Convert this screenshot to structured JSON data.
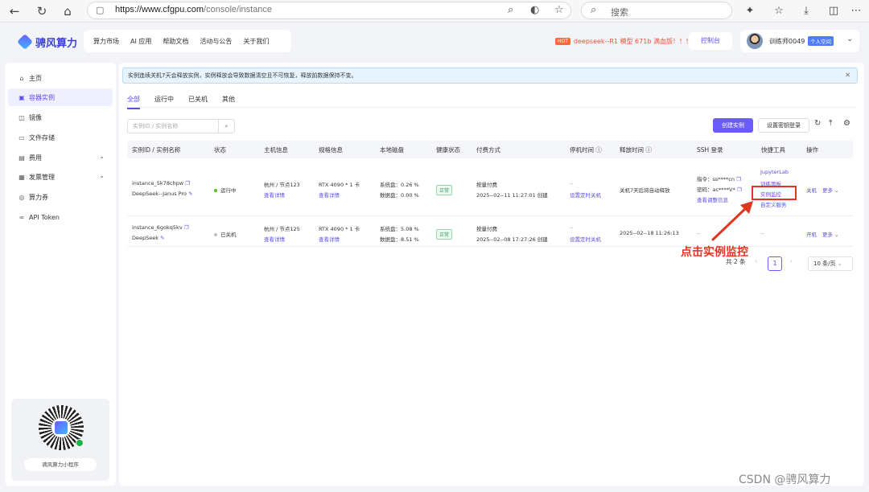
{
  "browser": {
    "url_prefix": "https://www.cfgpu.com",
    "url_path": "/console/instance",
    "search_placeholder": "搜索"
  },
  "header": {
    "logo_text": "骋风算力",
    "nav": [
      "算力市场",
      "AI 应用",
      "帮助文档",
      "活动与公告",
      "关于我们"
    ],
    "promo_tag": "HOT",
    "promo_text": "deepseek--R1 模型 671b 满血版！！！",
    "console_label": "控制台",
    "user_name": "训练师0049",
    "user_badge": "个人空间"
  },
  "sidebar": {
    "items": [
      {
        "label": "主页",
        "icon": "home-icon",
        "glyph": "⌂"
      },
      {
        "label": "容器实例",
        "icon": "container-icon",
        "glyph": "▣"
      },
      {
        "label": "镜像",
        "icon": "image-icon",
        "glyph": "◫"
      },
      {
        "label": "文件存储",
        "icon": "folder-icon",
        "glyph": "▭"
      },
      {
        "label": "费用",
        "icon": "billing-icon",
        "glyph": "▤"
      },
      {
        "label": "发票管理",
        "icon": "invoice-icon",
        "glyph": "▦"
      },
      {
        "label": "算力券",
        "icon": "coupon-icon",
        "glyph": "◎"
      },
      {
        "label": "API Token",
        "icon": "link-icon",
        "glyph": "∞"
      }
    ],
    "qr_label": "骋风算力小程序"
  },
  "main": {
    "notice": "实例连续关机7天会释放实例，实例释放会导致数据清空且不可恢复，释放前数据保持不变。",
    "tabs": [
      "全部",
      "运行中",
      "已关机",
      "其他"
    ],
    "filter_placeholder": "实例ID / 实例名称",
    "create_label": "创建实例",
    "key_label": "设置密钥登录",
    "columns": [
      "实例ID / 实例名称",
      "状态",
      "主机信息",
      "规格信息",
      "本地磁盘",
      "健康状态",
      "付费方式",
      "停机时间 ⓘ",
      "释放时间 ⓘ",
      "SSH 登录",
      "快捷工具",
      "操作"
    ],
    "rows": [
      {
        "id": "instance_5k78chpw",
        "name": "DeepSeek--Janus Pro",
        "status": "运行中",
        "status_color": "#52c41a",
        "host": "杭州 / 节点123",
        "host_link": "查看详情",
        "spec": "RTX 4090 * 1 卡",
        "spec_link": "查看详情",
        "disk_sys": "系统盘：0.26 %",
        "disk_data": "数据盘：0.00 %",
        "health": "正常",
        "pay": "按量付费",
        "pay_time": "2025--02--11 11:27:01 创建",
        "stop": "--",
        "stop_link": "设置定时关机",
        "release": "关机7天后将自动释放",
        "ssh_cmd": "指令：ss****cn",
        "ssh_pwd": "密码：ac****V*",
        "ssh_link": "查看调整信息",
        "tools": [
          "JupyterLab",
          "训练面板",
          "实例监控",
          "自定义服务"
        ],
        "op": "关机",
        "more": "更多"
      },
      {
        "id": "instance_6gokq5kv",
        "name": "DeepSeek",
        "status": "已关机",
        "status_color": "#bfbfbf",
        "host": "杭州 / 节点125",
        "host_link": "查看详情",
        "spec": "RTX 4090 * 1 卡",
        "spec_link": "查看详情",
        "disk_sys": "系统盘：5.08 %",
        "disk_data": "数据盘：8.51 %",
        "health": "正常",
        "pay": "按量付费",
        "pay_time": "2025--02--08 17:27:26 创建",
        "stop": "--",
        "stop_link": "设置定时关机",
        "release": "2025--02--18 11:26:13",
        "ssh": "--",
        "tools_none": "--",
        "op": "开机",
        "more": "更多"
      }
    ],
    "total": "共 2 条",
    "page": "1",
    "page_size": "10 条/页"
  },
  "annotation": {
    "text": "点击实例监控",
    "color": "#e0351f"
  },
  "watermark": "CSDN @骋风算力"
}
